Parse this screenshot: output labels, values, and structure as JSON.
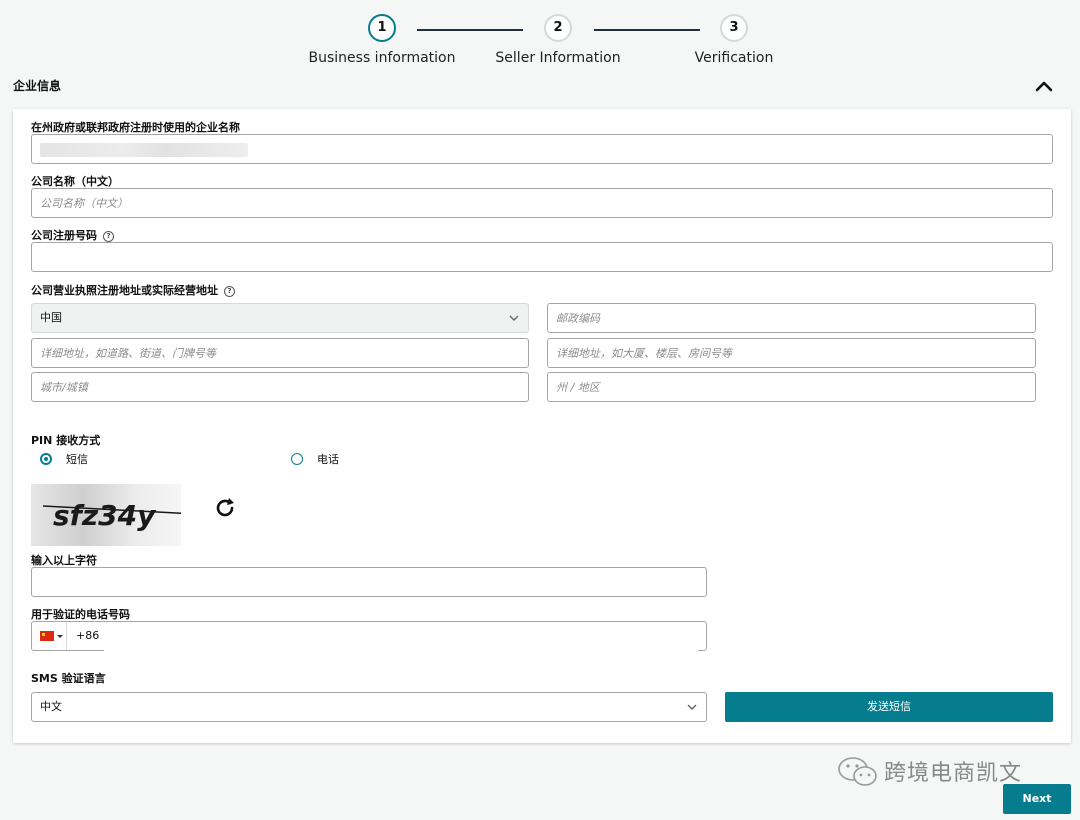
{
  "stepper": {
    "steps": [
      {
        "number": "1",
        "label": "Business information"
      },
      {
        "number": "2",
        "label": "Seller Information"
      },
      {
        "number": "3",
        "label": "Verification"
      }
    ]
  },
  "section": {
    "title": "企业信息"
  },
  "form": {
    "legal_name": {
      "label": "在州政府或联邦政府注册时使用的企业名称",
      "value": ""
    },
    "company_name_cn": {
      "label": "公司名称（中文）",
      "placeholder": "公司名称（中文）"
    },
    "registration_number": {
      "label": "公司注册号码",
      "value": ""
    },
    "address": {
      "label": "公司营业执照注册地址或实际经营地址",
      "country": "中国",
      "postal_placeholder": "邮政编码",
      "line1_placeholder": "详细地址，如道路、街道、门牌号等",
      "line2_placeholder": "详细地址，如大厦、楼层、房间号等",
      "city_placeholder": "城市/城镇",
      "state_placeholder": "州 / 地区"
    },
    "pin": {
      "label": "PIN 接收方式",
      "options": [
        {
          "label": "短信",
          "selected": true
        },
        {
          "label": "电话",
          "selected": false
        }
      ]
    },
    "captcha": {
      "text": "sfz34y",
      "input_label": "输入以上字符",
      "value": ""
    },
    "phone": {
      "label": "用于验证的电话号码",
      "country_code": "+86",
      "value": ""
    },
    "sms_language": {
      "label": "SMS 验证语言",
      "value": "中文"
    },
    "send_sms_label": "发送短信"
  },
  "footer": {
    "watermark": "跨境电商凯文",
    "next_label": "Next"
  },
  "colors": {
    "accent": "#067d8e",
    "navy": "#232f3e"
  }
}
